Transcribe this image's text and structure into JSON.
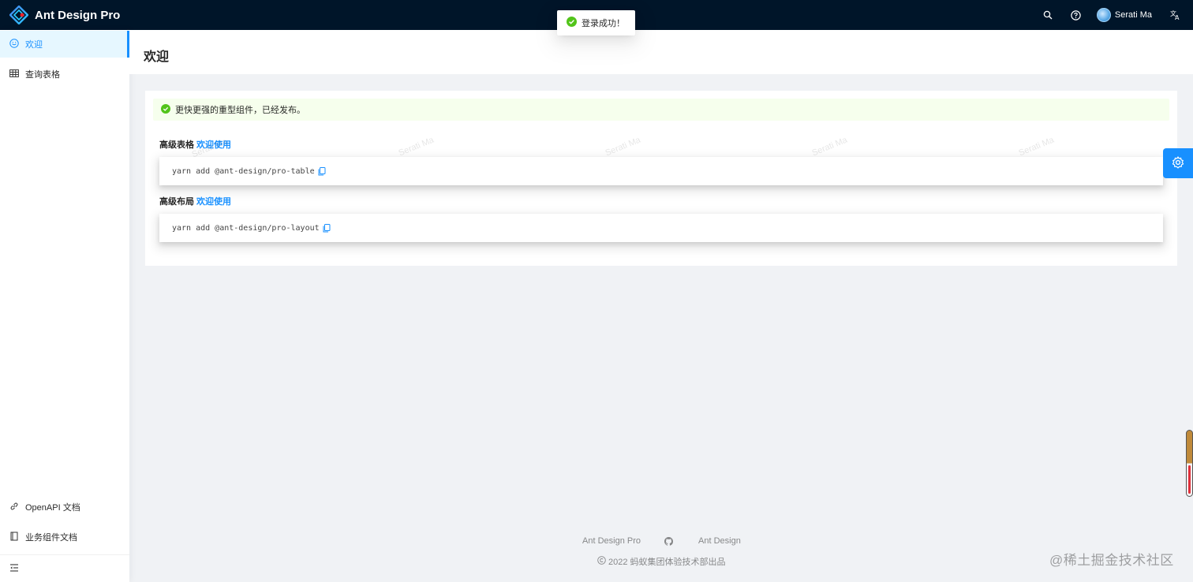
{
  "app": {
    "title": "Ant Design Pro"
  },
  "header": {
    "user_name": "Serati Ma",
    "icons": [
      "search-icon",
      "question-icon",
      "translate-icon"
    ]
  },
  "toast": {
    "message": "登录成功！",
    "type": "success",
    "color": "#52c41a"
  },
  "sidebar": {
    "items": [
      {
        "label": "欢迎",
        "icon": "smile-icon",
        "selected": true
      },
      {
        "label": "查询表格",
        "icon": "table-icon",
        "selected": false
      }
    ],
    "bottom_links": [
      {
        "label": "OpenAPI 文档",
        "icon": "link-icon"
      },
      {
        "label": "业务组件文档",
        "icon": "book-icon"
      }
    ],
    "collapse_icon": "menu-fold-icon"
  },
  "page": {
    "title": "欢迎",
    "alert": "更快更强的重型组件，已经发布。",
    "sections": [
      {
        "title": "高级表格",
        "link_label": "欢迎使用",
        "code": "yarn add @ant-design/pro-table"
      },
      {
        "title": "高级布局",
        "link_label": "欢迎使用",
        "code": "yarn add @ant-design/pro-layout"
      }
    ],
    "watermark": "Serati Ma"
  },
  "footer": {
    "links": [
      "Ant Design Pro",
      "Ant Design"
    ],
    "github_icon": "github-icon",
    "copyright": "2022 蚂蚁集团体验技术部出品"
  },
  "overlay_watermark": "@稀土掘金技术社区",
  "colors": {
    "header_bg": "#001529",
    "primary": "#1890ff",
    "success": "#52c41a",
    "alert_bg": "#f6ffed",
    "page_bg": "#f0f2f5"
  }
}
